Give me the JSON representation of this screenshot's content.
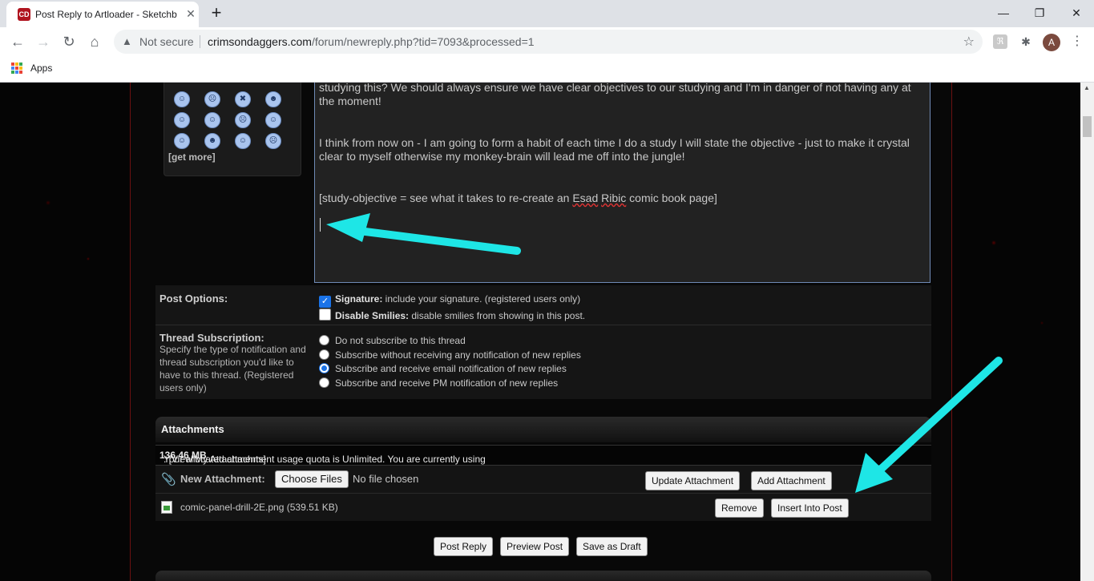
{
  "browser": {
    "tab_title": "Post Reply to Artloader - Sketchb",
    "tab_favicon_text": "CD",
    "not_secure": "Not secure",
    "url_domain": "crimsondaggers.com",
    "url_path": "/forum/newreply.php?tid=7093&processed=1",
    "avatar_letter": "A",
    "bookmark_apps": "Apps"
  },
  "smilies": {
    "faces": [
      "☺",
      "☹",
      "✖",
      "☻",
      "☺",
      "☺",
      "☹",
      "☺",
      "☺",
      "☻",
      "☺",
      "☹"
    ],
    "get_more": "[get more]"
  },
  "editor": {
    "line1": "studying this?  We should always ensure we have clear objectives to our studying and I'm in danger of not having any at the moment!",
    "line2": "I think from now on - I am going to form a habit of each time I do a study I will state the objective - just to make it crystal clear to myself otherwise my monkey-brain will lead me off into the jungle!",
    "line3_prefix": "[study-objective = see what it takes to re-create an ",
    "line3_name1": "Esad",
    "line3_name2": "Ribic",
    "line3_suffix": " comic book page]"
  },
  "post_options": {
    "label": "Post Options:",
    "signature_bold": "Signature:",
    "signature_text": " include your signature. (registered users only)",
    "signature_checked": true,
    "smilies_bold": "Disable Smilies:",
    "smilies_text": " disable smilies from showing in this post.",
    "smilies_checked": false
  },
  "subscription": {
    "label": "Thread Subscription:",
    "description": "Specify the type of notification and thread subscription you'd like to have to this thread. (Registered users only)",
    "options": [
      "Do not subscribe to this thread",
      "Subscribe without receiving any notification of new replies",
      "Subscribe and receive email notification of new replies",
      "Subscribe and receive PM notification of new replies"
    ],
    "selected_index": 2
  },
  "attachments": {
    "heading": "Attachments",
    "quota_prefix": "Your allocated attachment usage quota is Unlimited. You are currently using ",
    "quota_amount": "136.46 MB",
    "quota_suffix": ". [View My Attachments]",
    "new_label": "New Attachment:",
    "choose_files": "Choose Files",
    "no_file": "No file chosen",
    "update_button": "Update Attachment",
    "add_button": "Add Attachment",
    "file_name": "comic-panel-drill-2E.png (539.51 KB)",
    "remove_button": "Remove",
    "insert_button": "Insert Into Post"
  },
  "actions": {
    "post_reply": "Post Reply",
    "preview_post": "Preview Post",
    "save_draft": "Save as Draft"
  },
  "colors": {
    "annotation_arrow": "#1ee6e6",
    "site_accent": "#6b1010",
    "checkbox_blue": "#1a73e8"
  }
}
